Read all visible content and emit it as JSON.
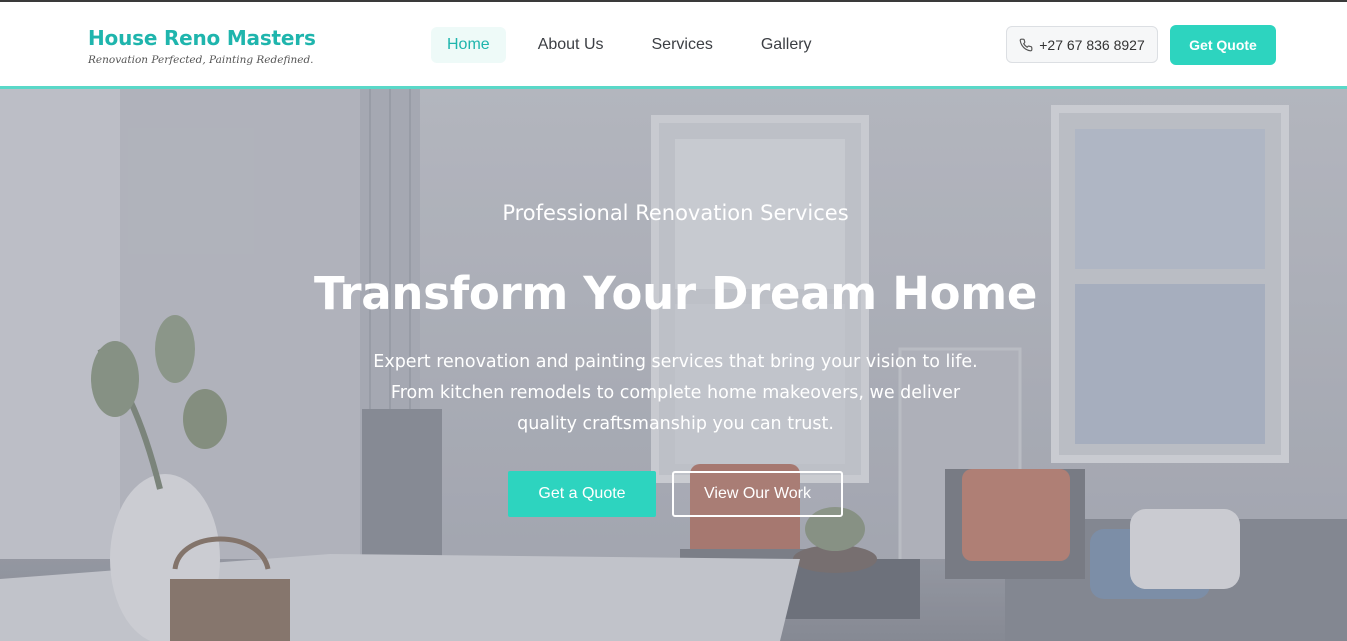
{
  "header": {
    "brand_name": "House Reno Masters",
    "brand_tagline": "Renovation Perfected, Painting Redefined.",
    "nav": [
      {
        "label": "Home",
        "active": true
      },
      {
        "label": "About Us",
        "active": false
      },
      {
        "label": "Services",
        "active": false
      },
      {
        "label": "Gallery",
        "active": false
      }
    ],
    "phone": "+27 67 836 8927",
    "phone_icon": "phone-icon",
    "quote_label": "Get Quote"
  },
  "hero": {
    "subtitle": "Professional Renovation Services",
    "title": "Transform Your Dream Home",
    "description": "Expert renovation and painting services that bring your vision to life. From kitchen remodels to complete home makeovers, we deliver quality craftsmanship you can trust.",
    "primary_cta": "Get a Quote",
    "secondary_cta": "View Our Work"
  },
  "colors": {
    "accent": "#2dd4bf",
    "brand_text": "#1fb5ad",
    "active_nav_bg": "#eefaf8"
  }
}
